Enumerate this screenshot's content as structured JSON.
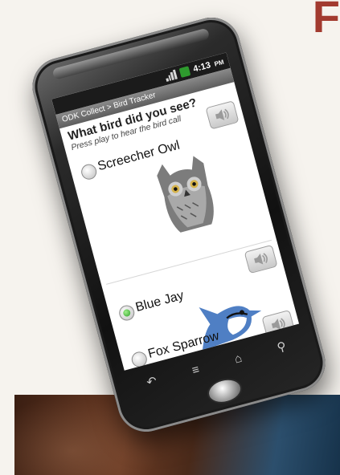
{
  "status_bar": {
    "time": "4:13",
    "ampm": "PM"
  },
  "app": {
    "breadcrumb": "ODK Collect > Bird Tracker"
  },
  "question": {
    "title": "What bird did you see?",
    "hint": "Press play to hear the bird call"
  },
  "options": [
    {
      "label": "Screecher Owl",
      "selected": false
    },
    {
      "label": "Blue Jay",
      "selected": true
    },
    {
      "label": "Fox Sparrow",
      "selected": false
    }
  ],
  "colors": {
    "accent_red": "#a23a2f",
    "radio_selected": "#2f9e2a"
  },
  "icons": [
    "signal-icon",
    "battery-icon",
    "speaker-icon",
    "back-icon",
    "menu-icon",
    "home-icon",
    "search-icon"
  ]
}
